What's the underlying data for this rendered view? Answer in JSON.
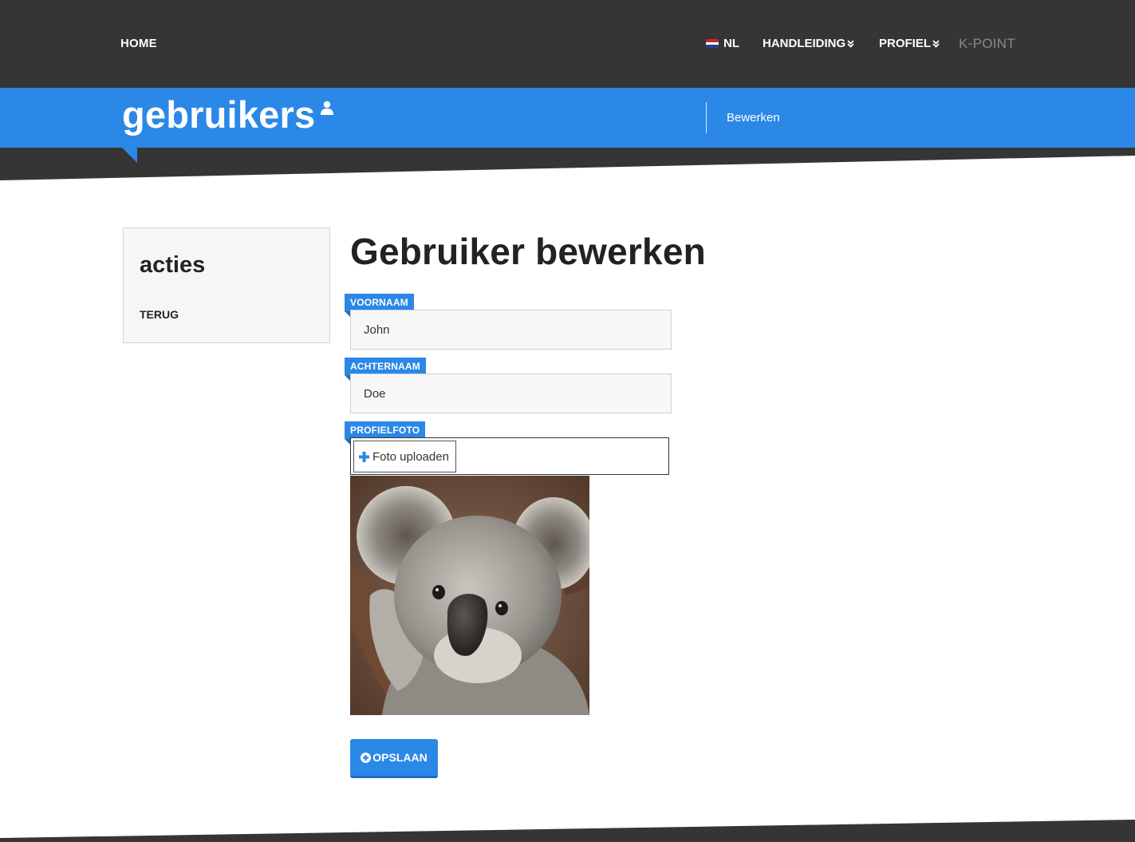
{
  "nav": {
    "home": "HOME",
    "language": "NL",
    "manual": "HANDLEIDING",
    "profile": "PROFIEL",
    "brand": "K-POINT"
  },
  "banner": {
    "title": "gebruikers",
    "action": "Bewerken"
  },
  "sidebar": {
    "title": "acties",
    "back_link": "TERUG"
  },
  "form": {
    "title": "Gebruiker bewerken",
    "first_name_label": "VOORNAAM",
    "first_name_value": "John",
    "last_name_label": "ACHTERNAAM",
    "last_name_value": "Doe",
    "photo_label": "PROFIELFOTO",
    "upload_label": "Foto uploaden",
    "save_label": "OPSLAAN"
  },
  "colors": {
    "nav_bg": "#353535",
    "accent": "#2b88e6",
    "kpoint": "#8a8a8a"
  },
  "icons": {
    "flag": "netherlands-flag-icon",
    "chevron": "double-chevron-down-icon",
    "user": "user-icon",
    "plus": "plus-icon",
    "save": "plus-circle-icon"
  }
}
